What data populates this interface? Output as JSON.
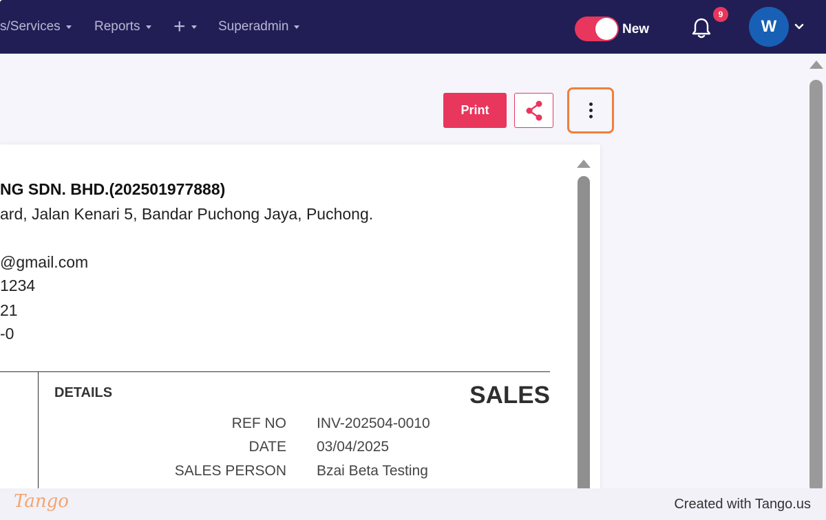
{
  "navbar": {
    "items": [
      {
        "label": "s/Services"
      },
      {
        "label": "Reports"
      },
      {
        "label": "+"
      },
      {
        "label": "Superadmin"
      }
    ],
    "toggle_label": "New",
    "notification_count": "9",
    "avatar_initial": "W"
  },
  "toolbar": {
    "print_label": "Print"
  },
  "invoice": {
    "company_name": "NG SDN. BHD.(202501977888)",
    "address": "ard, Jalan Kenari 5, Bandar Puchong Jaya, Puchong.",
    "email": "@gmail.com",
    "line_phone": "1234",
    "line_3": "21",
    "line_4": "-0",
    "details_title": "DETAILS",
    "doc_type": "SALES",
    "fields": [
      {
        "label": "REF NO",
        "value": "INV-202504-0010"
      },
      {
        "label": "DATE",
        "value": "03/04/2025"
      },
      {
        "label": "SALES PERSON",
        "value": "Bzai Beta Testing"
      }
    ]
  },
  "footer": {
    "logo_text": "Tango",
    "credit": "Created with Tango.us"
  },
  "colors": {
    "navbar_bg": "#211e55",
    "accent": "#e8365d",
    "highlight": "#f07f3c",
    "avatar_bg": "#1760b5"
  }
}
